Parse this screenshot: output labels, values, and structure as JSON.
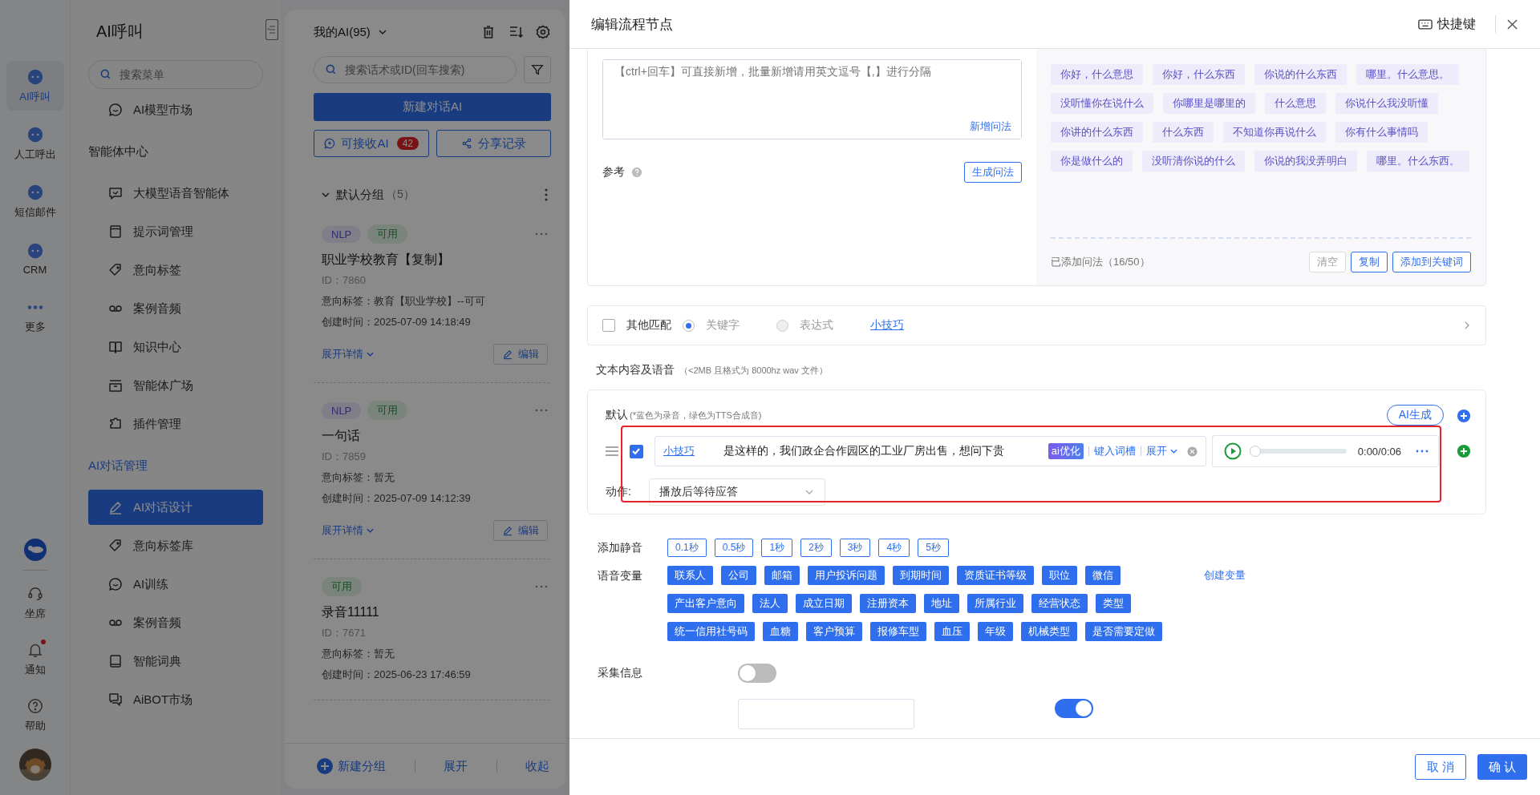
{
  "rail": {
    "items": [
      {
        "label": "AI呼叫",
        "selected": true
      },
      {
        "label": "人工呼出",
        "selected": false
      },
      {
        "label": "短信邮件",
        "selected": false
      },
      {
        "label": "CRM",
        "selected": false
      },
      {
        "label": "更多",
        "selected": false
      }
    ],
    "bottom": [
      {
        "label": "坐席",
        "badge": false
      },
      {
        "label": "通知",
        "badge": true
      },
      {
        "label": "帮助",
        "badge": false
      }
    ]
  },
  "menu": {
    "title": "AI呼叫",
    "search_placeholder": "搜索菜单",
    "items": [
      {
        "kind": "item",
        "label": "AI模型市场",
        "selected": false
      },
      {
        "kind": "heading",
        "label": "智能体中心",
        "active": false
      },
      {
        "kind": "item",
        "label": "大模型语音智能体",
        "selected": false
      },
      {
        "kind": "item",
        "label": "提示词管理",
        "selected": false
      },
      {
        "kind": "item",
        "label": "意向标签",
        "selected": false
      },
      {
        "kind": "item",
        "label": "案例音频",
        "selected": false
      },
      {
        "kind": "item",
        "label": "知识中心",
        "selected": false
      },
      {
        "kind": "item",
        "label": "智能体广场",
        "selected": false
      },
      {
        "kind": "item",
        "label": "插件管理",
        "selected": false
      },
      {
        "kind": "heading",
        "label": "AI对话管理",
        "active": true
      },
      {
        "kind": "item",
        "label": "AI对话设计",
        "selected": true
      },
      {
        "kind": "item",
        "label": "意向标签库",
        "selected": false
      },
      {
        "kind": "item",
        "label": "AI训练",
        "selected": false
      },
      {
        "kind": "item",
        "label": "案例音频",
        "selected": false
      },
      {
        "kind": "item",
        "label": "智能词典",
        "selected": false
      },
      {
        "kind": "item",
        "label": "AiBOT市场",
        "selected": false
      }
    ]
  },
  "ai_list": {
    "title": "我的AI(95)",
    "search_placeholder": "搜索话术或ID(回车搜索)",
    "new_button": "新建对话AI",
    "receive_button": "可接收AI",
    "receive_count": "42",
    "share_button": "分享记录",
    "group": {
      "name": "默认分组",
      "count": "（5）"
    },
    "cards": [
      {
        "tags": [
          {
            "label": "NLP",
            "kind": "nlp"
          },
          {
            "label": "可用",
            "kind": "status"
          }
        ],
        "title": "职业学校教育【复制】",
        "id": "ID：7860",
        "intent": "意向标签：教育【职业学校】--可可",
        "created": "创建时间：2025-07-09 14:18:49",
        "expand": "展开详情",
        "edit": "编辑"
      },
      {
        "tags": [
          {
            "label": "NLP",
            "kind": "nlp"
          },
          {
            "label": "可用",
            "kind": "status"
          }
        ],
        "title": "一句话",
        "id": "ID：7859",
        "intent": "意向标签：暂无",
        "created": "创建时间：2025-07-09 14:12:39",
        "expand": "展开详情",
        "edit": "编辑"
      },
      {
        "tags": [
          {
            "label": "可用",
            "kind": "status"
          }
        ],
        "title": "录音11111",
        "id": "ID：7671",
        "intent": "意向标签：暂无",
        "created": "创建时间：2025-06-23 17:46:59"
      }
    ],
    "footer": {
      "new_group": "新建分组",
      "expand": "展开",
      "collapse": "收起"
    }
  },
  "drawer": {
    "title": "编辑流程节点",
    "shortcut": "快捷键",
    "question": {
      "placeholder": "【ctrl+回车】可直接新增，批量新增请用英文逗号【,】进行分隔",
      "add_link": "新增问法",
      "reference_label": "参考",
      "generate_button": "生成问法",
      "phrases": [
        "你好，什么意思",
        "你好，什么东西",
        "你说的什么东西",
        "哪里。什么意思。",
        "没听懂你在说什么",
        "你哪里是哪里的",
        "什么意思",
        "你说什么我没听懂",
        "你讲的什么东西",
        "什么东西",
        "不知道你再说什么",
        "你有什么事情吗",
        "你是做什么的",
        "没听清你说的什么",
        "你说的我没弄明白",
        "哪里。什么东西。"
      ],
      "count": "已添加问法（16/50）",
      "buttons": [
        {
          "label": "清空",
          "disabled": true
        },
        {
          "label": "复制",
          "disabled": false
        },
        {
          "label": "添加到关键词",
          "disabled": false
        }
      ]
    },
    "match": {
      "checked": false,
      "label": "其他匹配",
      "options": [
        {
          "label": "关键字",
          "selected": true
        },
        {
          "label": "表达式",
          "selected": false
        }
      ],
      "tip_link": "小技巧"
    },
    "content": {
      "title": "文本内容及语音",
      "hint": "（<2MB 且格式为 8000hz wav 文件）",
      "default_label": "默认",
      "default_hint": "(*蓝色为录音，绿色为TTS合成音)",
      "ai_button": "AI生成",
      "line": {
        "checked": true,
        "tip_link": "小技巧",
        "text": "是这样的，我们政企合作园区的工业厂房出售，想问下贵",
        "ai_badge": "ai优化",
        "slot_link": "键入词槽",
        "expand_link": "展开",
        "time": "0:00/0:06",
        "level": 0
      },
      "action_label": "动作:",
      "action_value": "播放后等待应答"
    },
    "silence": {
      "label": "添加静音",
      "chips": [
        "0.1秒",
        "0.5秒",
        "1秒",
        "2秒",
        "3秒",
        "4秒",
        "5秒"
      ]
    },
    "variables": {
      "label": "语音变量",
      "create_link": "创建变量",
      "rows": [
        [
          "联系人",
          "公司",
          "邮箱",
          "用户投诉问题",
          "到期时间",
          "资质证书等级",
          "职位",
          "微信"
        ],
        [
          "产出客户意向",
          "法人",
          "成立日期",
          "注册资本",
          "地址",
          "所属行业",
          "经营状态",
          "类型"
        ],
        [
          "统一信用社号码",
          "血糖",
          "客户预算",
          "报修车型",
          "血压",
          "年级",
          "机械类型",
          "是否需要定做"
        ]
      ]
    },
    "collect": {
      "label": "采集信息",
      "on": false
    },
    "next_row": {
      "on": true
    },
    "footer": {
      "cancel": "取 消",
      "confirm": "确 认"
    }
  }
}
